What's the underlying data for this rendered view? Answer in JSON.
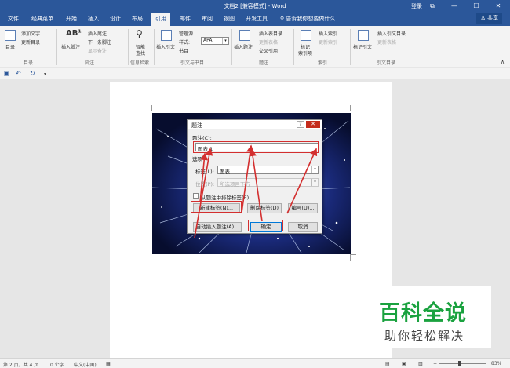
{
  "titlebar": {
    "title": "文档2 [兼容模式] - Word",
    "login": "登录",
    "restore": "⧉",
    "minimize": "—",
    "maximize": "☐",
    "close": "✕"
  },
  "tabs": [
    "文件",
    "经典菜单",
    "开始",
    "插入",
    "设计",
    "布局",
    "引用",
    "邮件",
    "审阅",
    "视图",
    "开发工具"
  ],
  "active_tab": "引用",
  "tell_me": "告诉我你想要做什么",
  "share": "共享",
  "ribbon": {
    "toc": "目录",
    "add_text": "添加文字",
    "update_toc": "更新目录",
    "insert_footnote": "插入脚注",
    "insert_endnote": "插入尾注",
    "next_footnote": "下一条脚注",
    "show_notes": "显示备注",
    "smart_lookup_1": "智能",
    "smart_lookup_2": "查找",
    "insert_citation": "插入引文",
    "manage_sources": "管理源",
    "style_label": "样式:",
    "style_value": "APA",
    "bibliography": "书目",
    "insert_caption": "插入题注",
    "insert_toc_figures": "插入表目录",
    "update_table": "更新表格",
    "cross_reference": "交叉引用",
    "mark_entry_1": "标记",
    "mark_entry_2": "索引项",
    "insert_index": "插入索引",
    "update_index": "更新索引",
    "mark_citation": "标记引文",
    "insert_toa": "插入引文目录",
    "update_toa": "更新表格",
    "groups": {
      "toc": "目录",
      "footnotes": "脚注",
      "research": "信息检索",
      "citations": "引文与书目",
      "captions": "题注",
      "index": "索引",
      "toa": "引文目录"
    }
  },
  "dialog": {
    "title": "题注",
    "help": "?",
    "close": "✕",
    "caption_label": "题注(C):",
    "caption_value": "图表 1",
    "options_label": "选项",
    "label_label": "标签(L):",
    "label_value": "图表",
    "position_label": "位置(P):",
    "position_value": "所选项目下方",
    "exclude_label": "从题注中排除标签(E)",
    "new_label_btn": "新建标签(N)...",
    "delete_label_btn": "删除标签(D)",
    "numbering_btn": "编号(U)...",
    "autocaption_btn": "自动插入题注(A)...",
    "ok_btn": "确定",
    "cancel_btn": "取消"
  },
  "status": {
    "page": "第 2 页，共 4 页",
    "words": "0 个字",
    "lang": "中文(中国)",
    "zoom": "83%"
  },
  "watermark": {
    "line1": "百科全说",
    "line2": "助你轻松解决"
  },
  "colors": {
    "word_blue": "#2b579a",
    "highlight_red": "#d32f2f",
    "watermark_green": "#1aa23f"
  }
}
